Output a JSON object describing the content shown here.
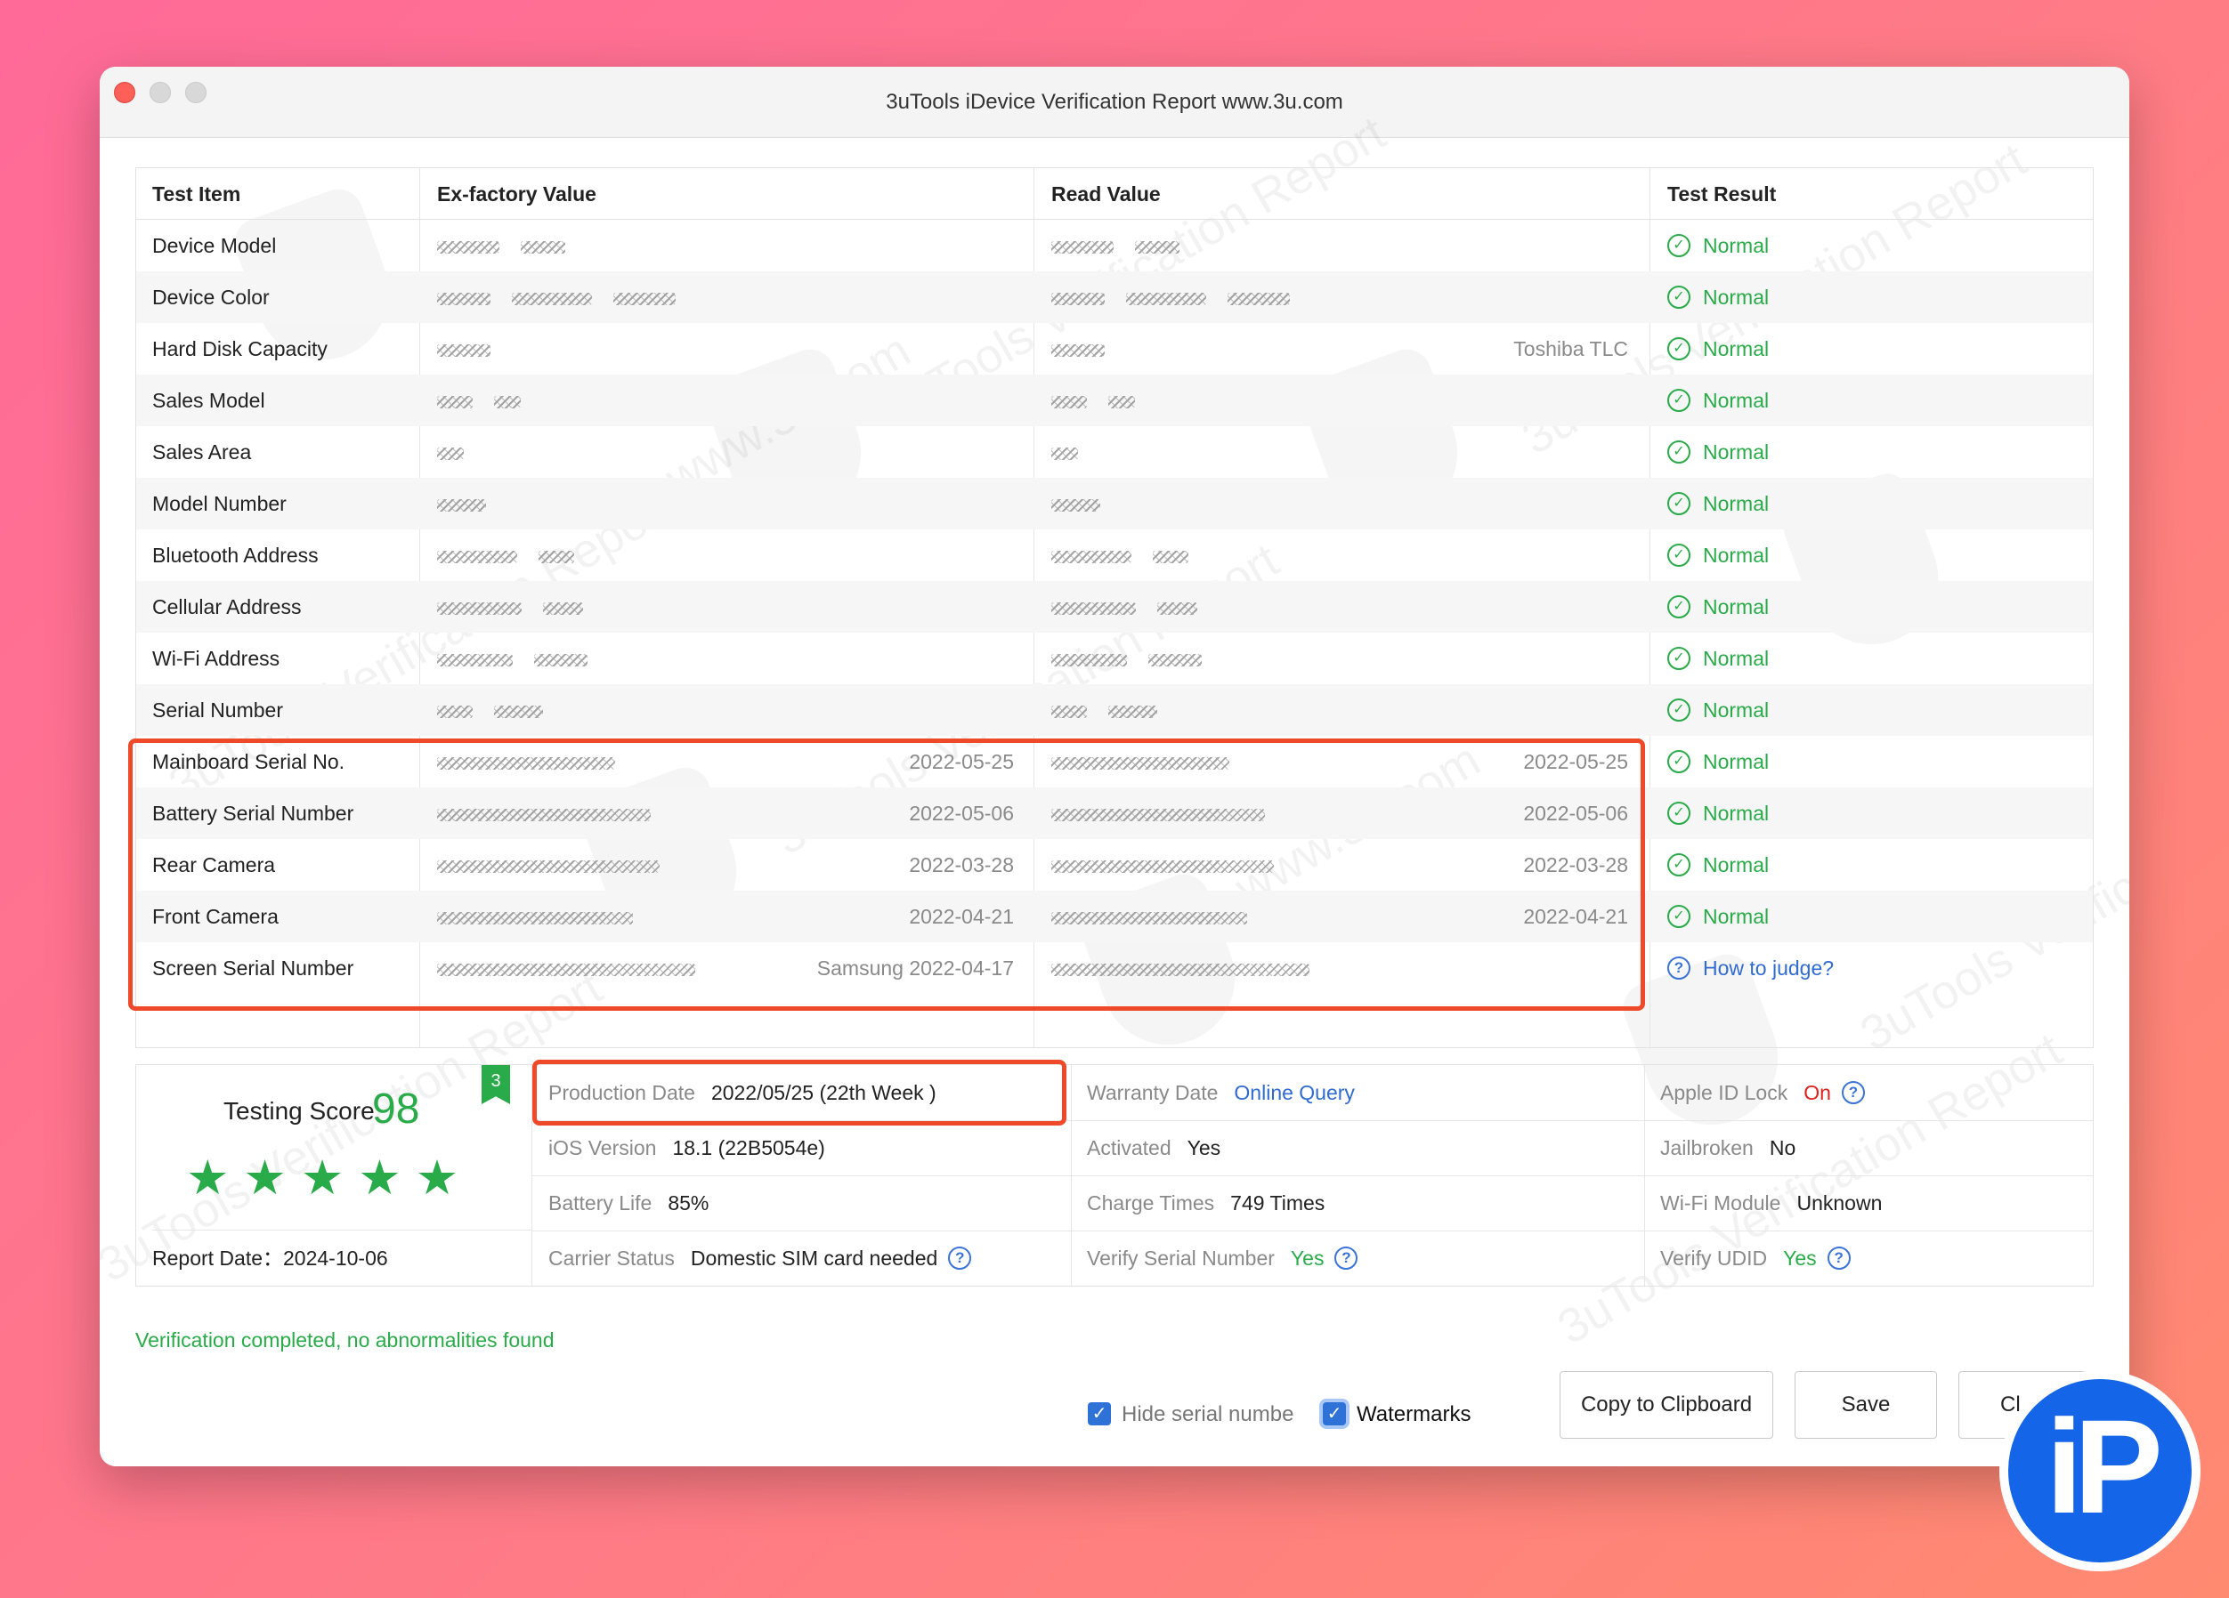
{
  "window": {
    "title": "3uTools iDevice Verification Report www.3u.com"
  },
  "watermark": {
    "text": "3uTools Verification Report",
    "site": "www.3u.com"
  },
  "table": {
    "headers": [
      "Test Item",
      "Ex-factory Value",
      "Read Value",
      "Test Result"
    ],
    "rows": [
      {
        "item": "Device Model",
        "ex_note": "",
        "read_note": "",
        "result": "Normal",
        "status": "normal"
      },
      {
        "item": "Device Color",
        "ex_note": "",
        "read_note": "",
        "result": "Normal",
        "status": "normal"
      },
      {
        "item": "Hard Disk Capacity",
        "ex_note": "",
        "read_note": "Toshiba TLC",
        "result": "Normal",
        "status": "normal"
      },
      {
        "item": "Sales Model",
        "ex_note": "",
        "read_note": "",
        "result": "Normal",
        "status": "normal"
      },
      {
        "item": "Sales Area",
        "ex_note": "",
        "read_note": "",
        "result": "Normal",
        "status": "normal"
      },
      {
        "item": "Model Number",
        "ex_note": "",
        "read_note": "",
        "result": "Normal",
        "status": "normal"
      },
      {
        "item": "Bluetooth Address",
        "ex_note": "",
        "read_note": "",
        "result": "Normal",
        "status": "normal"
      },
      {
        "item": "Cellular Address",
        "ex_note": "",
        "read_note": "",
        "result": "Normal",
        "status": "normal"
      },
      {
        "item": "Wi-Fi Address",
        "ex_note": "",
        "read_note": "",
        "result": "Normal",
        "status": "normal"
      },
      {
        "item": "Serial Number",
        "ex_note": "",
        "read_note": "",
        "result": "Normal",
        "status": "normal"
      },
      {
        "item": "Mainboard Serial No.",
        "ex_note": "2022-05-25",
        "read_note": "2022-05-25",
        "result": "Normal",
        "status": "normal"
      },
      {
        "item": "Battery Serial Number",
        "ex_note": "2022-05-06",
        "read_note": "2022-05-06",
        "result": "Normal",
        "status": "normal"
      },
      {
        "item": "Rear Camera",
        "ex_note": "2022-03-28",
        "read_note": "2022-03-28",
        "result": "Normal",
        "status": "normal"
      },
      {
        "item": "Front Camera",
        "ex_note": "2022-04-21",
        "read_note": "2022-04-21",
        "result": "Normal",
        "status": "normal"
      },
      {
        "item": "Screen Serial Number",
        "ex_note": "Samsung 2022-04-17",
        "read_note": "",
        "result": "How to judge?",
        "status": "unknown"
      }
    ]
  },
  "summary": {
    "score_label": "Testing Score",
    "score": "98",
    "badge": "3",
    "stars": 5,
    "report_date_label": "Report Date：",
    "report_date": "2024-10-06",
    "production_date_label": "Production Date",
    "production_date": "2022/05/25 (22th Week )",
    "ios_version_label": "iOS Version",
    "ios_version": "18.1 (22B5054e)",
    "battery_life_label": "Battery Life",
    "battery_life": "85%",
    "carrier_status_label": "Carrier Status",
    "carrier_status": "Domestic SIM card needed",
    "warranty_date_label": "Warranty Date",
    "warranty_date": "Online Query",
    "activated_label": "Activated",
    "activated": "Yes",
    "charge_times_label": "Charge Times",
    "charge_times": "749 Times",
    "verify_serial_label": "Verify Serial Number",
    "verify_serial": "Yes",
    "apple_id_lock_label": "Apple ID Lock",
    "apple_id_lock": "On",
    "jailbroken_label": "Jailbroken",
    "jailbroken": "No",
    "wifi_module_label": "Wi-Fi Module",
    "wifi_module": "Unknown",
    "verify_udid_label": "Verify UDID",
    "verify_udid": "Yes"
  },
  "footer": {
    "verification_message": "Verification completed, no abnormalities found",
    "hide_serial_label": "Hide serial numbe",
    "watermarks_label": "Watermarks",
    "copy_button": "Copy to Clipboard",
    "save_button": "Save",
    "close_button": "Cl"
  },
  "overlay_logo": {
    "text": "iP"
  },
  "colors": {
    "normal": "#2aab4a",
    "link": "#2f6bd3",
    "alert": "#e0201c",
    "highlight": "#ee4a2a"
  }
}
